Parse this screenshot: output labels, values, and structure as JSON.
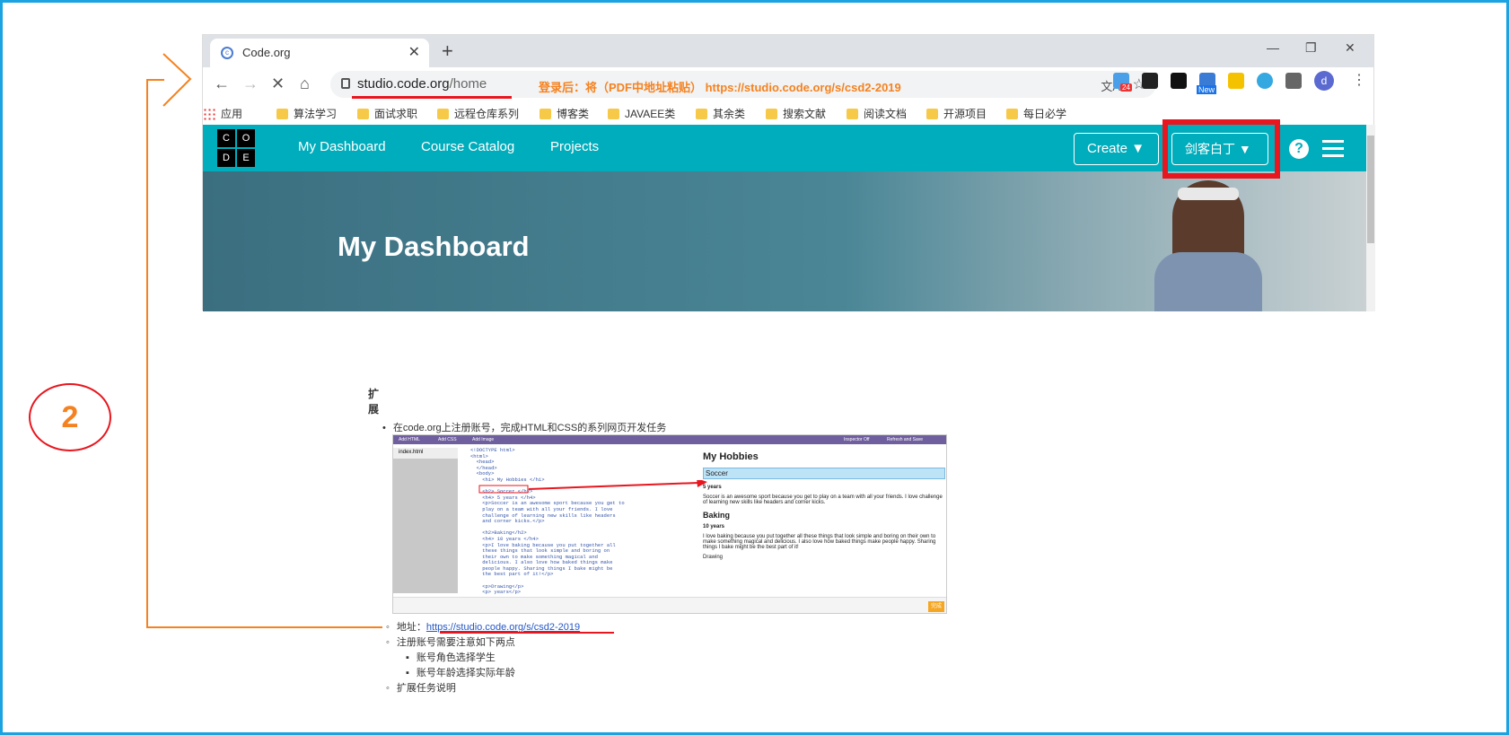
{
  "browser": {
    "tab_title": "Code.org",
    "new_tab": "+",
    "url_domain": "studio.code.org",
    "url_path": "/home",
    "annotation_note": "登录后：将（PDF中地址粘贴） https://studio.code.org/s/csd2-2019",
    "bookmarks": [
      "应用",
      "算法学习",
      "面试求职",
      "远程仓库系列",
      "博客类",
      "JAVAEE类",
      "其余类",
      "搜索文献",
      "阅读文档",
      "开源项目",
      "每日必学"
    ],
    "ext_badges": {
      "e1": "24",
      "e2": "New"
    },
    "avatar_letter": "d"
  },
  "site": {
    "logo": [
      "C",
      "O",
      "D",
      "E"
    ],
    "nav": [
      "My Dashboard",
      "Course Catalog",
      "Projects"
    ],
    "create_label": "Create",
    "user_label": "剑客白丁",
    "help": "?",
    "banner_title": "My Dashboard"
  },
  "doc": {
    "heading": "扩展",
    "item1": "在code.org上注册账号，完成HTML和CSS的系列网页开发任务",
    "address_label": "地址：",
    "address_link": "https://studio.code.org/s/csd2-2019",
    "notes_title": "注册账号需要注意如下两点",
    "note1": "账号角色选择学生",
    "note2": "账号年龄选择实际年龄",
    "task_desc": "扩展任务说明"
  },
  "embedded": {
    "file": "index.html",
    "toolbar": [
      "Add HTML",
      "Add CSS",
      "Add Image",
      "Inspector Off",
      "Refresh and Save"
    ],
    "code": "<!DOCTYPE html>\n<html>\n  <head>\n  </head>\n  <body>\n    <h1> My Hobbies </h1>\n\n    <h2> Soccer </h2>\n    <h4> 5 years </h4>\n    <p>Soccer is an awesome sport because you get to\n    play on a team with all your friends. I love\n    challenge of learning new skills like headers\n    and corner kicks.</p>\n\n    <h2>Baking</h2>\n    <h4> 10 years </h4>\n    <p>I love baking because you put together all\n    these things that look simple and boring on\n    their own to make something magical and\n    delicious. I also love how baked things make\n    people happy. Sharing things I bake might be\n    the best part of it!</p>\n\n    <p>Drawing</p>\n    <p> years</p>",
    "preview_title": "My Hobbies",
    "preview_h2a": "Soccer",
    "preview_years_a": "5 years",
    "preview_p_a": "Soccer is an awesome sport because you get to play on a team with all your friends. I love challenge of learning new skills like headers and corner kicks.",
    "preview_h2b": "Baking",
    "preview_years_b": "10 years",
    "preview_p_b": "I love baking because you put together all these things that look simple and boring on their own to make something magical and delicious. I also love how baked things make people happy. Sharing things I bake might be the best part of it!",
    "preview_drawing": "Drawing",
    "done": "完成"
  },
  "annotation": {
    "step_number": "2"
  },
  "colors": {
    "accent_orange": "#f58220",
    "annot_red": "#e8161e",
    "codeorg_teal": "#00adbc",
    "frame_blue": "#1aa3e0"
  }
}
